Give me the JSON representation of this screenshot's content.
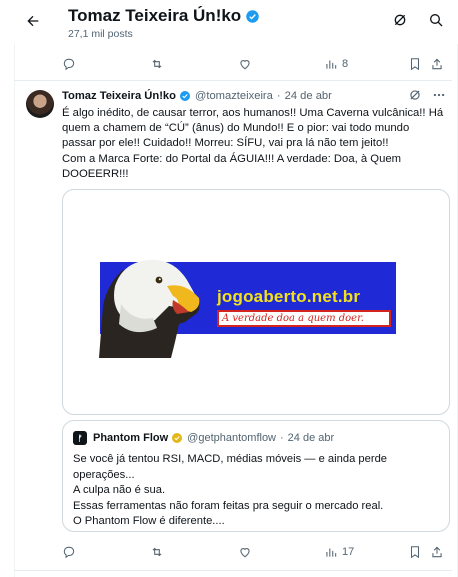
{
  "header": {
    "title": "Tomaz Teixeira Ún!ko",
    "subtitle": "27,1 mil posts"
  },
  "top_actions": {
    "views": "8"
  },
  "tweet": {
    "author_name": "Tomaz Teixeira Ún!ko",
    "handle": "@tomazteixeira",
    "date": "24 de abr",
    "text_lines": [
      "É algo inédito, de causar terror, aos humanos!! Uma Caverna vulcânica!! Há",
      "quem a chamem de “CÚ” (ânus) do Mundo!! E o pior: vai todo mundo",
      "passar por ele!! Cuidado!! Morreu: SÍFU, vai pra lá não tem jeito!!",
      "Com a Marca Forte: do Portal da ÁGUIA!!! A verdade: Doa, à Quem",
      "DOOEERR!!!"
    ],
    "image": {
      "site": "jogoaberto.net.br",
      "slogan": "A verdade doa a quem doer."
    },
    "views": "17"
  },
  "quote": {
    "name": "Phantom Flow",
    "handle": "@getphantomflow",
    "date": "24 de abr",
    "lines": [
      "Se você já tentou RSI, MACD, médias móveis — e ainda perde",
      "operações...",
      "A culpa não é sua.",
      "Essas ferramentas não foram feitas pra seguir o mercado real.",
      "O Phantom Flow é diferente...."
    ]
  },
  "colors": {
    "verified_blue": "#1d9bf0",
    "gold_badge": "#e2b719",
    "banner_blue": "#1f2ad6",
    "site_yellow": "#f3e11a",
    "slogan_red": "#d3241f"
  },
  "icons": [
    "back-arrow-icon",
    "grok-icon",
    "search-icon",
    "reply-icon",
    "retweet-icon",
    "like-icon",
    "views-icon",
    "bookmark-icon",
    "share-icon",
    "more-icon"
  ]
}
